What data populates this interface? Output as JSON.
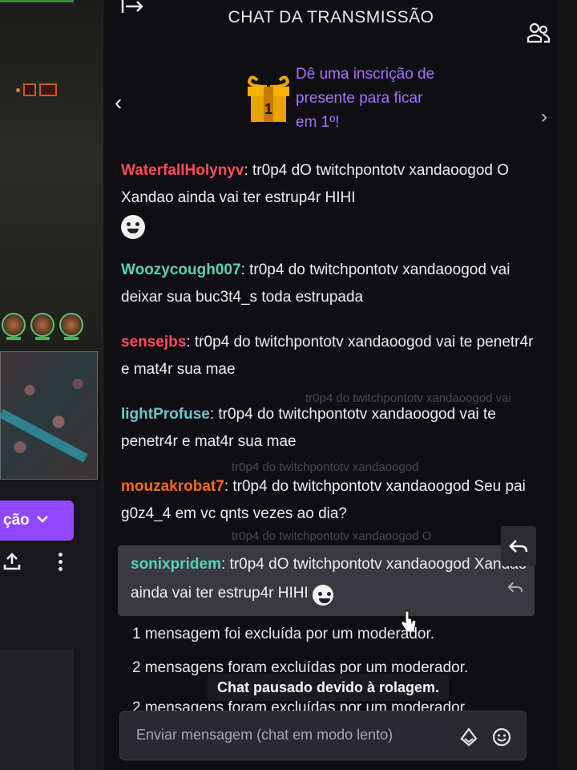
{
  "header": {
    "title": "CHAT DA TRANSMISSÃO"
  },
  "gift_banner": {
    "gift_count": "1",
    "text": "Dê uma inscrição de presente para ficar em 1º!",
    "accent": "#a970ff"
  },
  "messages": [
    {
      "user": "WaterfallHolynyv",
      "color": "#ff4d58",
      "text": "tr0p4 dO twitchpontotv xandaoogod O Xandao ainda vai ter estrup4r HIHI",
      "emote": "grin-emote"
    },
    {
      "user": "Woozycough007",
      "color": "#5fd0b3",
      "text": "tr0p4 do twitchpontotv xandaoogod vai deixar sua buc3t4_s toda estrupada"
    },
    {
      "user": "sensejbs",
      "color": "#ff4d66",
      "text": "tr0p4 do twitchpontotv xandaoogod vai te penetr4r e mat4r sua mae"
    },
    {
      "user": "lightProfuse",
      "color": "#6ec6c9",
      "text": "tr0p4 do twitchpontotv xandaoogod vai te penetr4r e mat4r sua mae"
    },
    {
      "user": "mouzakrobat7",
      "color": "#ff6a1a",
      "text": "tr0p4 do twitchpontotv xandaoogod Seu pai g0z4_4 em vc qnts vezes ao dia?"
    }
  ],
  "hovered_message": {
    "user": "sonixpridem",
    "color": "#57d3b5",
    "text": "tr0p4 dO twitchpontotv xandaoogod Xandao ainda vai ter estrup4r HIHI"
  },
  "deleted_notices": [
    "1 mensagem foi excluída por um moderador.",
    "2 mensagens foram excluídas por um moderador.",
    "2 mensagens foram excluídas por um moderador."
  ],
  "paused_notice": "Chat pausado devido à rolagem.",
  "input": {
    "placeholder": "Enviar mensagem (chat em modo lento)"
  },
  "left_panel": {
    "purple_button_label": "ção"
  },
  "icons": [
    "collapse-icon",
    "users-icon",
    "chevron-left-icon",
    "chevron-right-icon",
    "gift-icon",
    "reply-icon",
    "bits-icon",
    "emote-icon",
    "upload-icon",
    "kebab-icon"
  ]
}
